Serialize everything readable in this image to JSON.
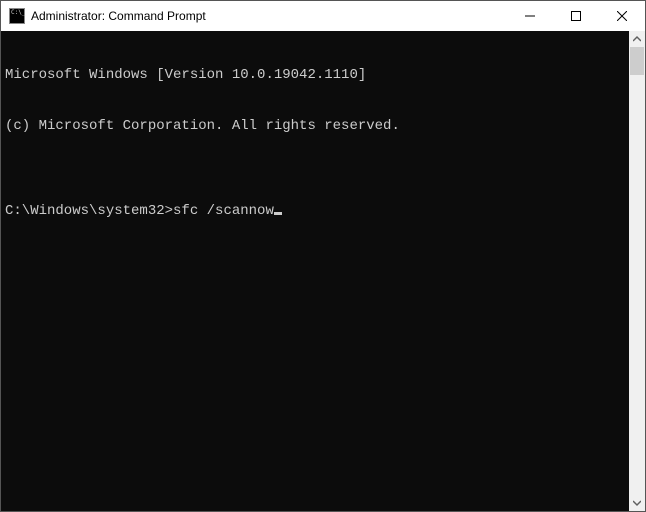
{
  "window": {
    "title": "Administrator: Command Prompt"
  },
  "terminal": {
    "line1": "Microsoft Windows [Version 10.0.19042.1110]",
    "line2": "(c) Microsoft Corporation. All rights reserved.",
    "blank": "",
    "prompt": "C:\\Windows\\system32>",
    "command": "sfc /scannow"
  },
  "icons": {
    "minimize": "minimize-icon",
    "maximize": "maximize-icon",
    "close": "close-icon",
    "scroll_up": "scroll-up-icon",
    "scroll_down": "scroll-down-icon"
  }
}
